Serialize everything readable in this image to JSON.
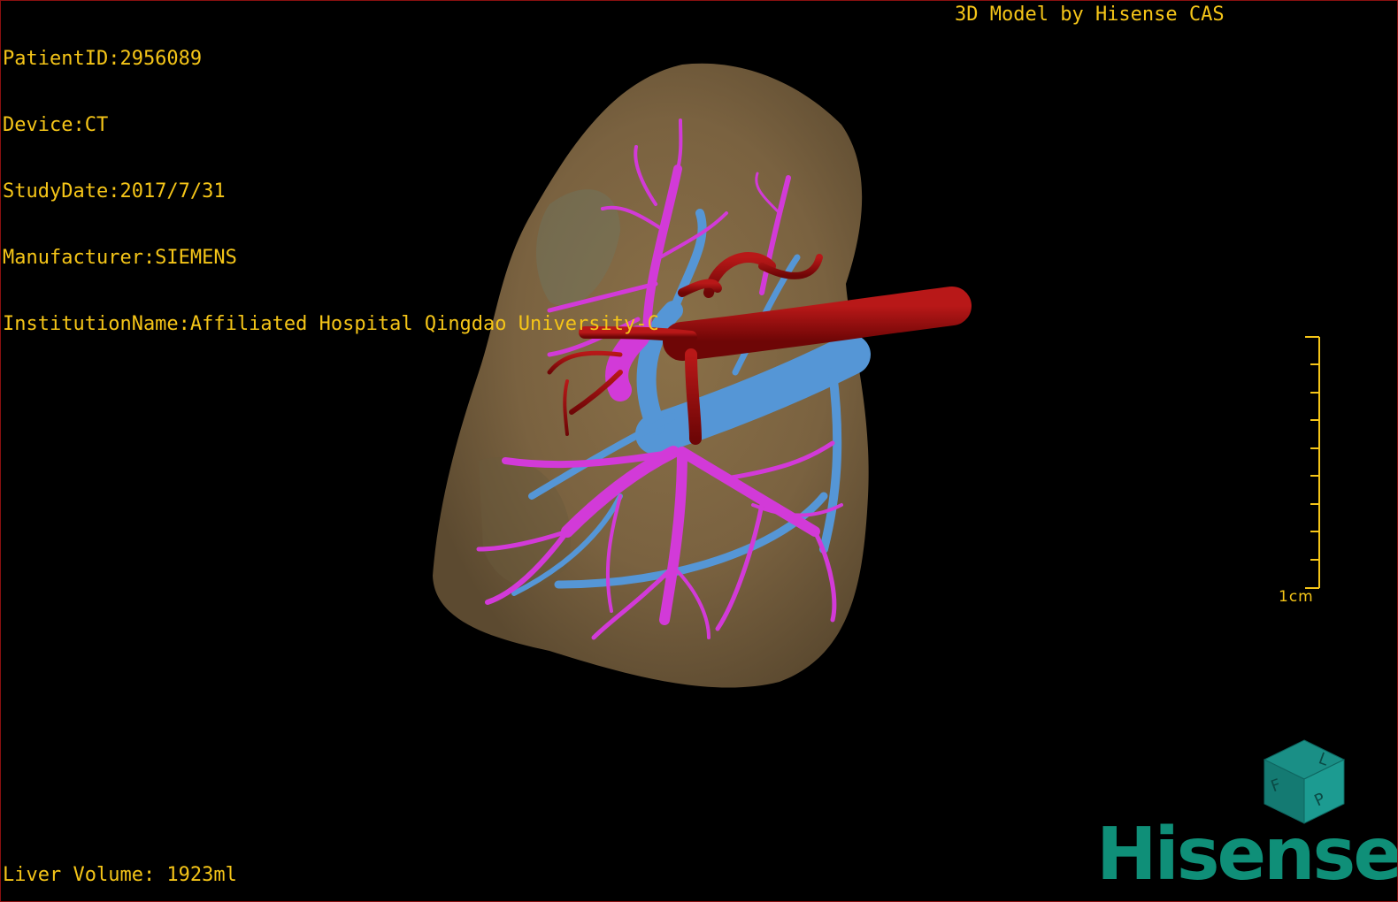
{
  "overlay": {
    "patient_id": "PatientID:2956089",
    "device": "Device:CT",
    "study_date": "StudyDate:2017/7/31",
    "manufacturer": "Manufacturer:SIEMENS",
    "institution": "InstitutionName:Affiliated Hospital Qingdao University-C",
    "model_credit": "3D Model by Hisense CAS",
    "liver_volume": "Liver Volume: 1923ml"
  },
  "scale_bar": {
    "label": "1cm"
  },
  "orientation_cube": {
    "face_labels": [
      "F",
      "L",
      "P"
    ]
  },
  "brand": {
    "logo_text": "Hisense"
  },
  "colors": {
    "overlay_text": "#f5c518",
    "liver": "#7d6540",
    "hepatic_veins": "#d23ad8",
    "portal_vein": "#5596d6",
    "artery": "#9a0c0c",
    "brand": "#0f8f78"
  }
}
